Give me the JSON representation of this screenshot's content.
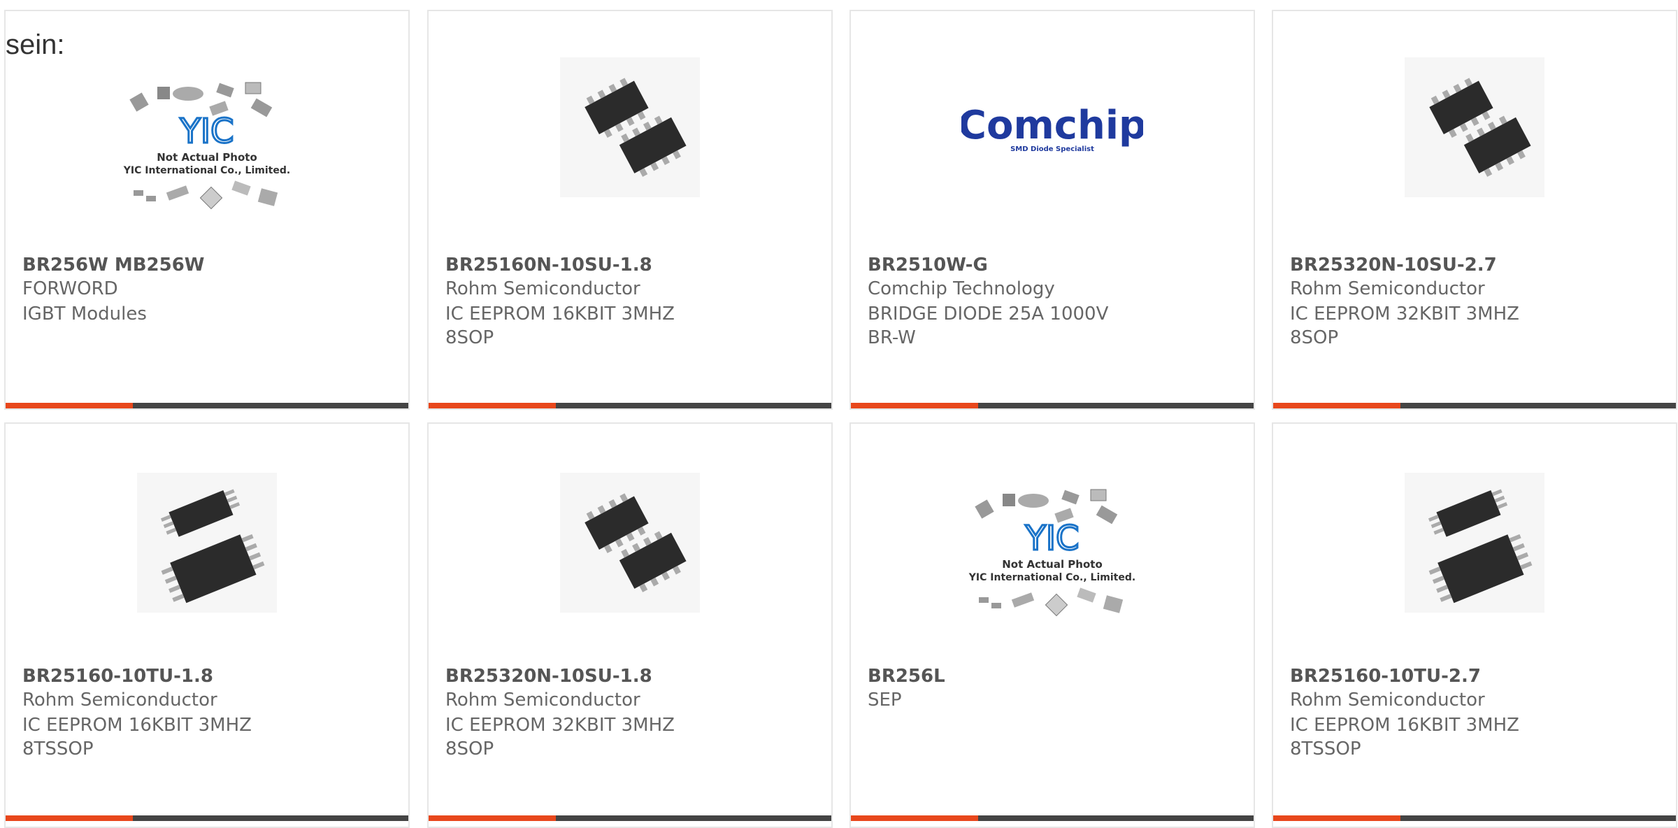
{
  "lead_text": "sein:",
  "colors": {
    "accent": "#e8471c",
    "bar": "#444444",
    "border": "#e6e6e6"
  },
  "products": [
    {
      "part": "BR256W MB256W",
      "maker": "FORWORD",
      "desc": "IGBT Modules",
      "image": "yic-placeholder",
      "photo_lines": [
        "Not Actual Photo",
        "YIC International Co., Limited."
      ]
    },
    {
      "part": "BR25160N-10SU-1.8",
      "maker": "Rohm Semiconductor",
      "desc": "IC EEPROM 16KBIT 3MHZ 8SOP",
      "image": "sop8-chip"
    },
    {
      "part": "BR2510W-G",
      "maker": "Comchip Technology",
      "desc": "BRIDGE DIODE 25A 1000V BR-W",
      "image": "comchip-logo",
      "logo_text": "Comchip",
      "logo_tagline": "SMD Diode Specialist"
    },
    {
      "part": "BR25320N-10SU-2.7",
      "maker": "Rohm Semiconductor",
      "desc": "IC EEPROM 32KBIT 3MHZ 8SOP",
      "image": "sop8-chip"
    },
    {
      "part": "BR25160-10TU-1.8",
      "maker": "Rohm Semiconductor",
      "desc": "IC EEPROM 16KBIT 3MHZ 8TSSOP",
      "image": "tssop8-chip"
    },
    {
      "part": "BR25320N-10SU-1.8",
      "maker": "Rohm Semiconductor",
      "desc": "IC EEPROM 32KBIT 3MHZ 8SOP",
      "image": "sop8-chip"
    },
    {
      "part": "BR256L",
      "maker": "SEP",
      "desc": "",
      "image": "yic-placeholder",
      "photo_lines": [
        "Not Actual Photo",
        "YIC International Co., Limited."
      ]
    },
    {
      "part": "BR25160-10TU-2.7",
      "maker": "Rohm Semiconductor",
      "desc": "IC EEPROM 16KBIT 3MHZ 8TSSOP",
      "image": "tssop8-chip"
    }
  ]
}
